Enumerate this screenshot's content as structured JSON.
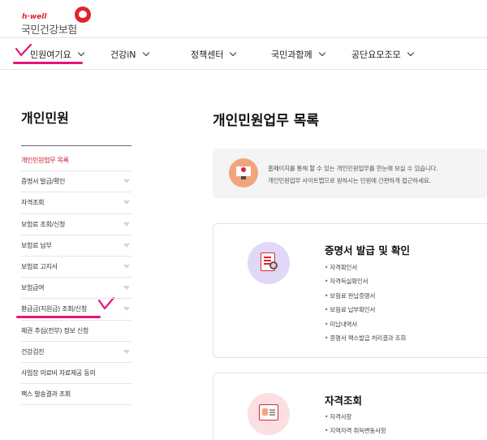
{
  "brand": {
    "tagline": "h·well",
    "name": "국민건강보험"
  },
  "gnb": [
    {
      "label": "민원여기요"
    },
    {
      "label": "건강iN"
    },
    {
      "label": "정책센터"
    },
    {
      "label": "국민과함께"
    },
    {
      "label": "공단요모조모"
    }
  ],
  "annotation_color": "#e6147d",
  "sidebar": {
    "title": "개인민원",
    "items": [
      {
        "label": "개인민원업무 목록",
        "active": true
      },
      {
        "label": "증명서 발급/확인"
      },
      {
        "label": "자격조회"
      },
      {
        "label": "보험료 조회/신청"
      },
      {
        "label": "보험료 납부"
      },
      {
        "label": "보험료 고지서"
      },
      {
        "label": "보험급여"
      },
      {
        "label": "환급금(지원금) 조회/신청"
      },
      {
        "label": "체권 추심(전부) 정보 신청"
      },
      {
        "label": "건강검진"
      },
      {
        "label": "사업장 의료비 자료제공 동의"
      },
      {
        "label": "팩스 발송결과 조회"
      }
    ]
  },
  "main": {
    "title": "개인민원업무 목록",
    "info": {
      "line1": "홈페이지를 통해 할 수 있는 개인민원업무를 한눈에 보실 수 있습니다.",
      "line2": "개인민원업무 사이트맵으로 원하시는 민원에 간편하게 접근하세요."
    },
    "cards": [
      {
        "title": "증명서 발급 및 확인",
        "icon": "certificate-icon",
        "items": [
          "자격확인서",
          "자격득실확인서",
          "보험료 완납증명서",
          "보험료 납부확인서",
          "미납내역서",
          "증명서 팩스발급 처리결과 조회"
        ]
      },
      {
        "title": "자격조회",
        "icon": "id-card-icon",
        "items": [
          "자격사항",
          "지역자격 취득변동사항"
        ]
      }
    ]
  }
}
